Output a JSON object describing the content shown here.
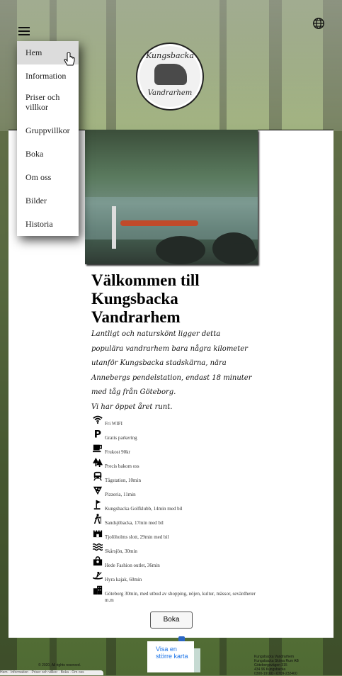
{
  "menu": {
    "items": [
      "Hem",
      "Information",
      "Priser och villkor",
      "Gruppvillkor",
      "Boka",
      "Om oss",
      "Bilder",
      "Historia"
    ],
    "active": "Hem"
  },
  "logo": {
    "top_text": "Kungsbacka",
    "bottom_text": "Vandrarhem"
  },
  "main": {
    "title": "Välkommen till Kungsbacka Vandrarhem",
    "intro_1": "Lantligt och naturskönt ligger detta populära vandrarhem bara några kilometer utanför Kungsbacka stadskärna, nära Annebergs pendelstation, endast 18 minuter med tåg från Göteborg.",
    "intro_2": "Vi har öppet året runt."
  },
  "amenities": [
    {
      "icon": "wifi-icon",
      "text": "Fri WIFI"
    },
    {
      "icon": "parking-icon",
      "text": "Gratis parkering"
    },
    {
      "icon": "coffee-cup-icon",
      "text": "Frukost 90kr"
    },
    {
      "icon": "forest-icon",
      "text": "Precis bakom oss"
    },
    {
      "icon": "train-icon",
      "text": "Tågstation, 10min"
    },
    {
      "icon": "pizza-icon",
      "text": "Pizzeria, 11min"
    },
    {
      "icon": "golf-icon",
      "text": "Kungsbacka Golfklubb, 14min med bil"
    },
    {
      "icon": "hiking-icon",
      "text": "Sandsjöbacka, 17min med bil"
    },
    {
      "icon": "castle-icon",
      "text": "Tjolöholms slott, 29min med bil"
    },
    {
      "icon": "waves-icon",
      "text": "Skårsjön, 30min"
    },
    {
      "icon": "shopping-bag-icon",
      "text": "Hede Fashion outlet, 36min"
    },
    {
      "icon": "kayak-icon",
      "text": "Hyra kajak, 60min"
    },
    {
      "icon": "city-icon",
      "text": "Göteborg 30min, med utbud av shopping, nöjen, kultur, mässor, sevärdheter m.m"
    }
  ],
  "book_button": "Boka",
  "footer": {
    "copyright": "© 2020, All rights reserved.",
    "map_link": "Visa en större karta",
    "address_lines": [
      "Kungsbacka Vandrarhem",
      "Kungsbacka Sköna Rum AB",
      "Göteborgsvägen 315",
      "434 96 Kungsbacka",
      "0300-19160 · 0709-232460"
    ],
    "bottom_text": "Hem · Information · Priser och villkor · Boka · Om oss"
  }
}
